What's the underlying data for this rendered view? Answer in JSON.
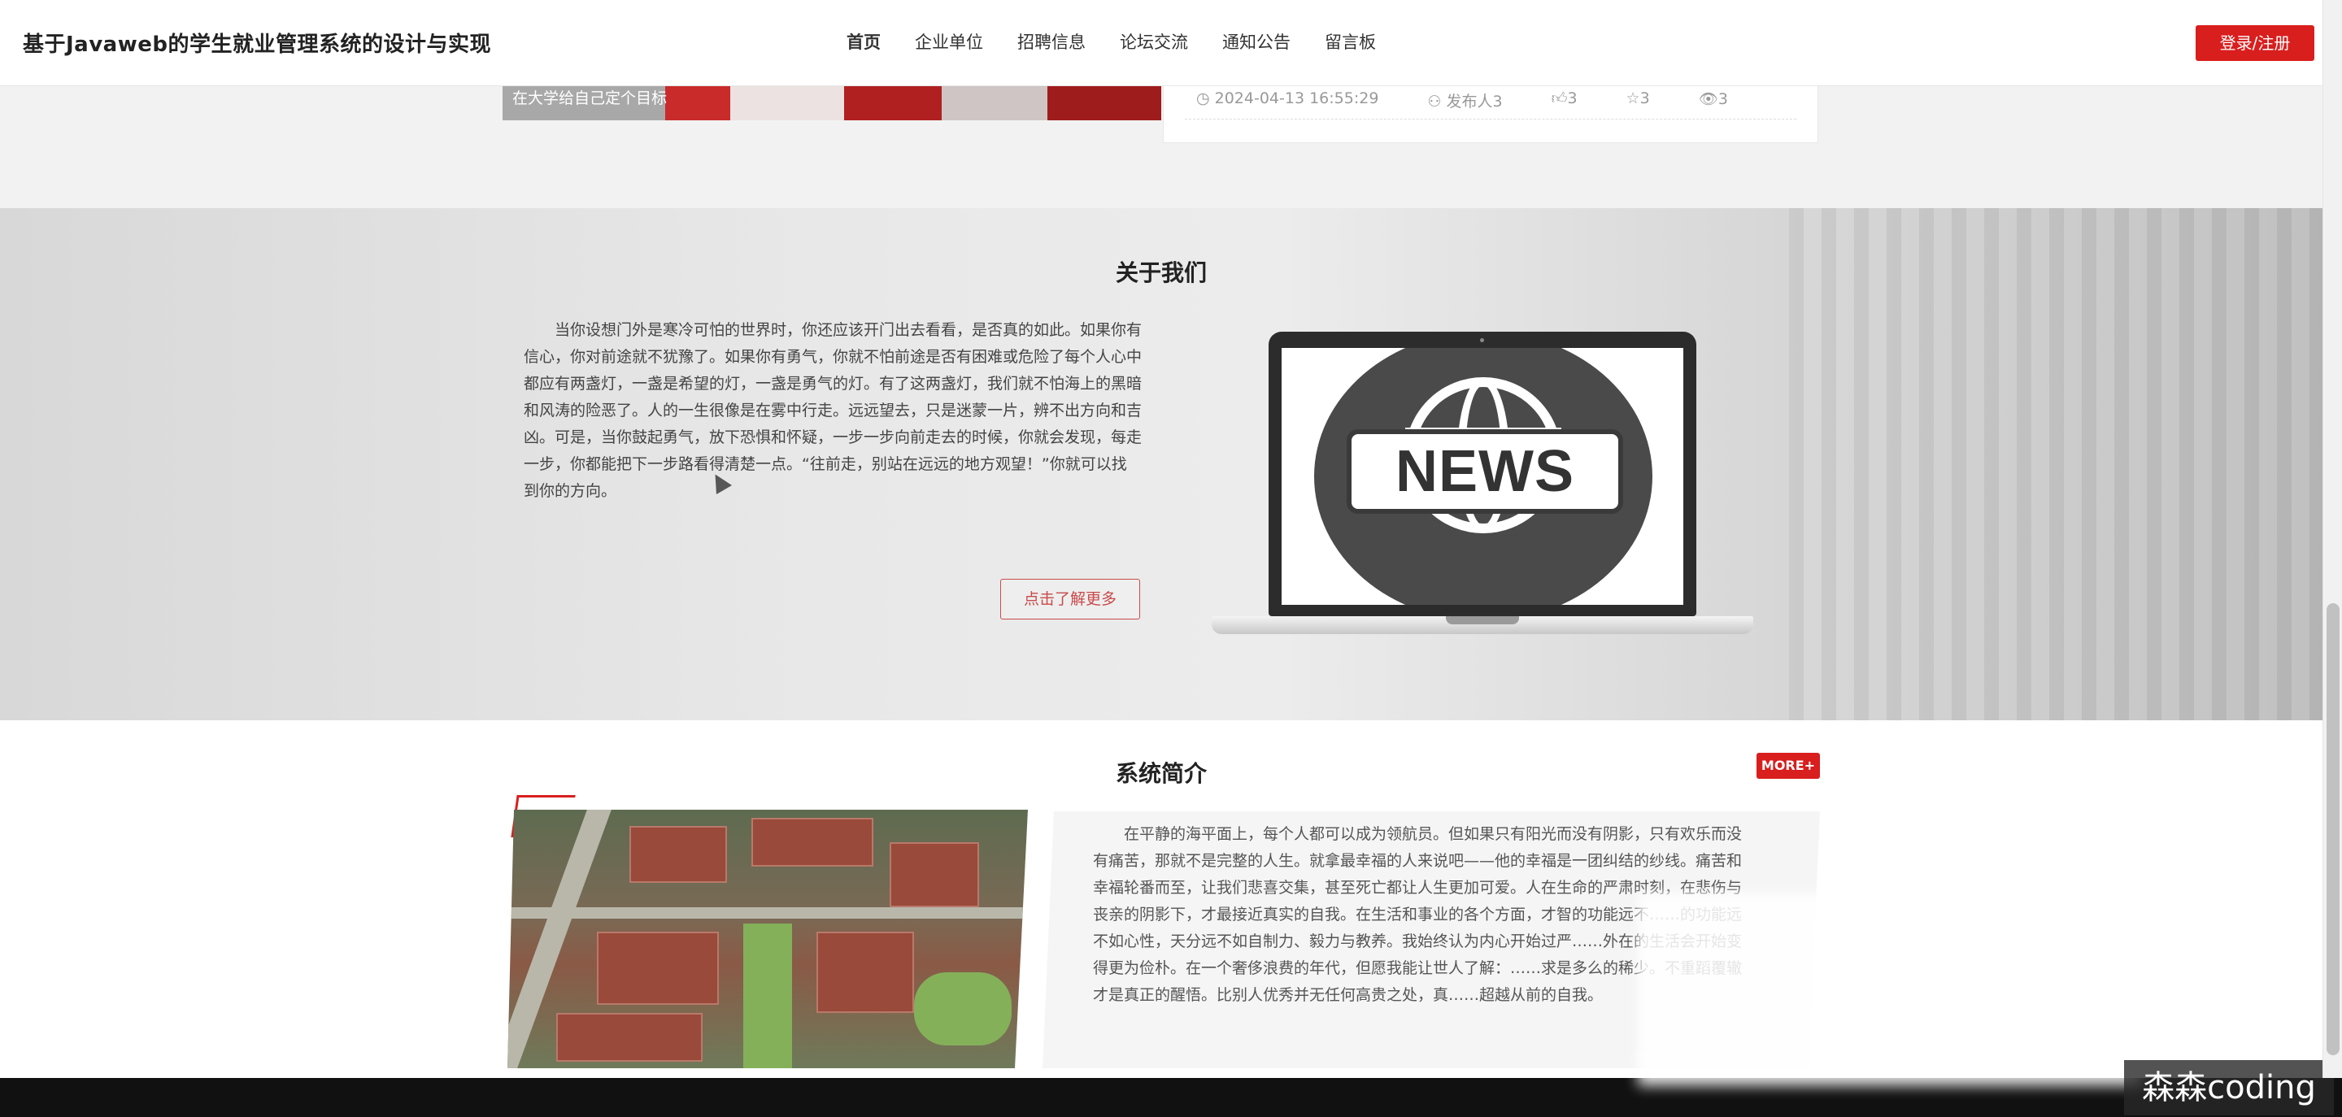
{
  "app": {
    "title": "基于Javaweb的学生就业管理系统的设计与实现"
  },
  "nav": {
    "items": [
      {
        "label": "首页",
        "active": true
      },
      {
        "label": "企业单位",
        "active": false
      },
      {
        "label": "招聘信息",
        "active": false
      },
      {
        "label": "论坛交流",
        "active": false
      },
      {
        "label": "通知公告",
        "active": false
      },
      {
        "label": "留言板",
        "active": false
      }
    ],
    "login_label": "登录/注册",
    "accent_color": "#d91e1e"
  },
  "banner": {
    "caption": "在大学给自己定个目标"
  },
  "news_card": {
    "date": "2024-04-13 16:55:29",
    "author": "发布人3",
    "likes": "3",
    "favorites": "3",
    "views": "3"
  },
  "about": {
    "title": "关于我们",
    "text": "当你设想门外是寒冷可怕的世界时，你还应该开门出去看看，是否真的如此。如果你有信心，你对前途就不犹豫了。如果你有勇气，你就不怕前途是否有困难或危险了每个人心中都应有两盏灯，一盏是希望的灯，一盏是勇气的灯。有了这两盏灯，我们就不怕海上的黑暗和风涛的险恶了。人的一生很像是在雾中行走。远远望去，只是迷蒙一片，辨不出方向和吉凶。可是，当你鼓起勇气，放下恐惧和怀疑，一步一步向前走去的时候，你就会发现，每走一步，你都能把下一步路看得清楚一点。“往前走，别站在远远的地方观望！”你就可以找到你的方向。",
    "button_label": "点击了解更多",
    "image_label": "NEWS"
  },
  "intro": {
    "title": "系统简介",
    "more_label": "MORE+",
    "text": "在平静的海平面上，每个人都可以成为领航员。但如果只有阳光而没有阴影，只有欢乐而没有痛苦，那就不是完整的人生。就拿最幸福的人来说吧——他的幸福是一团纠结的纱线。痛苦和幸福轮番而至，让我们悲喜交集，甚至死亡都让人生更加可爱。人在生命的严肃时刻，在悲伤与丧亲的阴影下，才最接近真实的自我。在生活和事业的各个方面，才智的功能远不……的功能远不如心性，天分远不如自制力、毅力与教养。我始终认为内心开始过严……外在的生活会开始变得更为俭朴。在一个奢侈浪费的年代，但愿我能让世人了解：……求是多么的稀少。不重蹈覆辙才是真正的醒悟。比别人优秀并无任何高贵之处，真……超越从前的自我。"
  },
  "watermark": {
    "text": "森森coding"
  }
}
